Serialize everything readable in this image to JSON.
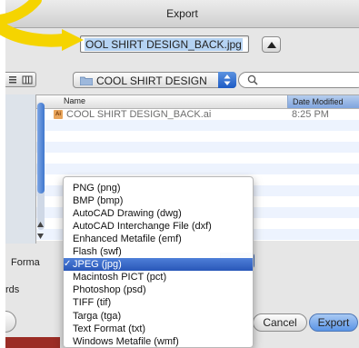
{
  "window": {
    "title": "Export"
  },
  "save_as": {
    "filename": "COOL SHIRT DESIGN_BACK",
    "extension": ".jpg",
    "visible_value": "OOL SHIRT DESIGN_BACK.jpg"
  },
  "toolbar": {
    "location": "COOL SHIRT DESIGN",
    "search_value": ""
  },
  "browser": {
    "columns": {
      "name": "Name",
      "date_modified": "Date Modified"
    },
    "files": [
      {
        "name": "COOL SHIRT DESIGN_BACK.ai",
        "date": "8:25 PM",
        "icon": "ai-file-icon"
      }
    ]
  },
  "format": {
    "label": "Forma",
    "selected": "JPEG (jpg)",
    "check_mark": "✓",
    "options": [
      "PNG (png)",
      "BMP (bmp)",
      "AutoCAD Drawing (dwg)",
      "AutoCAD Interchange File (dxf)",
      "Enhanced Metafile (emf)",
      "Flash (swf)",
      "JPEG (jpg)",
      "Macintosh PICT (pct)",
      "Photoshop (psd)",
      "TIFF (tif)",
      "Targa (tga)",
      "Text Format (txt)",
      "Windows Metafile (wmf)"
    ]
  },
  "options_label": "rds",
  "buttons": {
    "cancel": "Cancel",
    "export": "Export"
  },
  "colors": {
    "accent": "#2957b8",
    "annotation": "#f5d400"
  }
}
